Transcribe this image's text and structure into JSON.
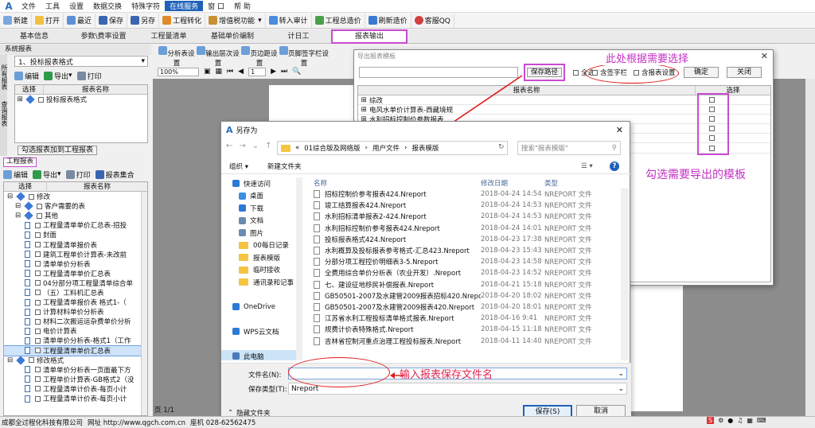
{
  "menubar": {
    "items": [
      "文件",
      "工具",
      "设置",
      "数据交换",
      "特殊字符",
      "在线服务",
      "窗 口",
      "帮 助"
    ]
  },
  "toolbar": {
    "items": [
      "新建",
      "打开",
      "最近",
      "保存",
      "另存",
      "工程转化",
      "增值税功能",
      "转入审计",
      "工程总造价",
      "刷新造价",
      "客服QQ"
    ]
  },
  "tabs": [
    "基本信息",
    "参数\\费率设置",
    "工程量清单",
    "基础单价编制",
    "计日工",
    "报表输出"
  ],
  "left_panel": {
    "system_reports_title": "系统报表",
    "format_select": "1、投标报表格式",
    "vtab_labels": [
      "所有报表",
      "查询报表"
    ],
    "edit": "编辑",
    "export": "导出",
    "print": "打印",
    "col_select": "选择",
    "col_name": "报表名称",
    "system_row": "投标报表格式",
    "add_to_project": "勾选报表加到工程报表",
    "project_reports_title": "工程报表",
    "report_set": "报表集合",
    "tree": [
      {
        "label": "修改",
        "level": 0,
        "type": "group"
      },
      {
        "label": "客户需要的表",
        "level": 1,
        "type": "group"
      },
      {
        "label": "其他",
        "level": 1,
        "type": "group"
      },
      {
        "label": "工程量清单单价汇总表-招投",
        "level": 2,
        "type": "doc"
      },
      {
        "label": "封面",
        "level": 2,
        "type": "doc"
      },
      {
        "label": "工程量清单报价表",
        "level": 2,
        "type": "doc"
      },
      {
        "label": "建筑工程单价计算表-未改前",
        "level": 2,
        "type": "doc"
      },
      {
        "label": "清单单价分析表",
        "level": 2,
        "type": "doc"
      },
      {
        "label": "工程量清单单价汇总表",
        "level": 2,
        "type": "doc"
      },
      {
        "label": "04分部分项工程量清单综合单",
        "level": 2,
        "type": "doc"
      },
      {
        "label": "（五）工料机汇总表",
        "level": 2,
        "type": "doc"
      },
      {
        "label": "工程量清单报价表 格式1-（",
        "level": 2,
        "type": "doc"
      },
      {
        "label": "计算材料单价分析表",
        "level": 2,
        "type": "doc"
      },
      {
        "label": "材料二次搬运运杂费单价分析",
        "level": 2,
        "type": "doc"
      },
      {
        "label": "电价计算表",
        "level": 2,
        "type": "doc"
      },
      {
        "label": "清单单价分析表-格式1（工作",
        "level": 2,
        "type": "doc"
      },
      {
        "label": "工程量清单单价汇总表",
        "level": 2,
        "type": "doc",
        "selected": true
      },
      {
        "label": "修改格式",
        "level": 0,
        "type": "group"
      },
      {
        "label": "清单单价分析表一页面最下方",
        "level": 2,
        "type": "doc"
      },
      {
        "label": "工程单价计算表-GB格式2（没",
        "level": 2,
        "type": "doc"
      },
      {
        "label": "工程量清单计价表-每页小计",
        "level": 2,
        "type": "doc"
      },
      {
        "label": "工程量清单计价表-每页小计",
        "level": 2,
        "type": "doc"
      }
    ]
  },
  "right_toolbar": {
    "items": [
      "分析表设置",
      "输出层次设置",
      "页边距设置",
      "页脚签字栏设置"
    ],
    "zoom": "100%",
    "page": "1"
  },
  "export_dialog": {
    "title": "导出报表模板",
    "save_path_btn": "保存路径",
    "select_all": "全选",
    "sign_col": "含签字栏",
    "report_setting": "含报表设置",
    "ok": "确定",
    "close": "关闭",
    "col_name": "报表名称",
    "col_select": "选择",
    "rows": [
      "综改",
      "电风水单价计算表-西藏境规",
      "水利招标控制价参数报表",
      "",
      "",
      ""
    ]
  },
  "annotations": {
    "choose_here": "此处根据需要选择",
    "check_templates": "勾选需要导出的模板",
    "enter_name": "输入报表保存文件名"
  },
  "saveas": {
    "title": "另存为",
    "breadcrumb": [
      "«",
      "01综合版及网络版",
      "用户文件",
      "报表模版"
    ],
    "search_placeholder": "搜索\"报表模版\"",
    "organize": "组织 ▾",
    "new_folder": "新建文件夹",
    "col_name": "名称",
    "col_date": "修改日期",
    "col_type": "类型",
    "nav": [
      {
        "label": "快速访问",
        "type": "star",
        "indent": 0
      },
      {
        "label": "桌面",
        "type": "desk",
        "indent": 1
      },
      {
        "label": "下载",
        "type": "down",
        "indent": 1
      },
      {
        "label": "文档",
        "type": "docs",
        "indent": 1
      },
      {
        "label": "图片",
        "type": "pics",
        "indent": 1
      },
      {
        "label": "00每日记录",
        "type": "folder",
        "indent": 1
      },
      {
        "label": "报表模版",
        "type": "folder",
        "indent": 1
      },
      {
        "label": "临时接收",
        "type": "folder",
        "indent": 1
      },
      {
        "label": "通讯录和记事",
        "type": "folder",
        "indent": 1
      },
      {
        "label": "",
        "type": "none",
        "indent": 0
      },
      {
        "label": "OneDrive",
        "type": "cloud",
        "indent": 0
      },
      {
        "label": "",
        "type": "none",
        "indent": 0
      },
      {
        "label": "WPS云文档",
        "type": "cloud",
        "indent": 0
      },
      {
        "label": "",
        "type": "none",
        "indent": 0
      },
      {
        "label": "此电脑",
        "type": "pc",
        "indent": 0
      },
      {
        "label": "网络",
        "type": "net",
        "indent": 0
      }
    ],
    "files": [
      {
        "name": "招标控制价参考报表424.Nreport",
        "date": "2018-04-24 14:54",
        "type": "NREPORT 文件"
      },
      {
        "name": "竣工结算报表424.Nreport",
        "date": "2018-04-24 14:53",
        "type": "NREPORT 文件"
      },
      {
        "name": "水利招标清单报表2-424.Nreport",
        "date": "2018-04-24 14:53",
        "type": "NREPORT 文件"
      },
      {
        "name": "水利招标控制价参考报表424.Nreport",
        "date": "2018-04-24 14:01",
        "type": "NREPORT 文件"
      },
      {
        "name": "投标报表格式424.Nreport",
        "date": "2018-04-23 17:38",
        "type": "NREPORT 文件"
      },
      {
        "name": "水利概算及投标报表参考格式-汇总423.Nreport",
        "date": "2018-04-23 15:43",
        "type": "NREPORT 文件"
      },
      {
        "name": "分部分项工程控价明细表3-5.Nreport",
        "date": "2018-04-23 14:58",
        "type": "NREPORT 文件"
      },
      {
        "name": "全费用综合单价分析表（农业开发）.Nreport",
        "date": "2018-04-23 14:52",
        "type": "NREPORT 文件"
      },
      {
        "name": "七、建设征地移民补偿报表.Nreport",
        "date": "2018-04-21 15:18",
        "type": "NREPORT 文件"
      },
      {
        "name": "GB50501-2007及水建管2009报表招标420.Nreport",
        "date": "2018-04-20 18:02",
        "type": "NREPORT 文件"
      },
      {
        "name": "GB50501-2007及水建管2009报表420.Nreport",
        "date": "2018-04-20 18:01",
        "type": "NREPORT 文件"
      },
      {
        "name": "江苏省水利工程投标清单格式报表.Nreport",
        "date": "2018-04-16 9:41",
        "type": "NREPORT 文件"
      },
      {
        "name": "规费计价表特殊格式.Nreport",
        "date": "2018-04-15 11:18",
        "type": "NREPORT 文件"
      },
      {
        "name": "吉林省控制河重点治理工程投标报表.Nreport",
        "date": "2018-04-11 14:40",
        "type": "NREPORT 文件"
      }
    ],
    "filename_label": "文件名(N):",
    "filename_value": "",
    "filetype_label": "保存类型(T):",
    "filetype_value": "Nreport",
    "hide_folders": "隐藏文件夹",
    "save_btn": "保存(S)",
    "cancel_btn": "取消"
  },
  "statusbar": {
    "company": "成都全过程化科技有限公司",
    "website": "网址 http://www.qgch.com.cn",
    "phone": "座机 028-62562475",
    "page_info": "页 1/1"
  },
  "colors": {
    "accent": "#1e62b8",
    "magenta": "#c84bd1",
    "red": "#e01a1a"
  }
}
